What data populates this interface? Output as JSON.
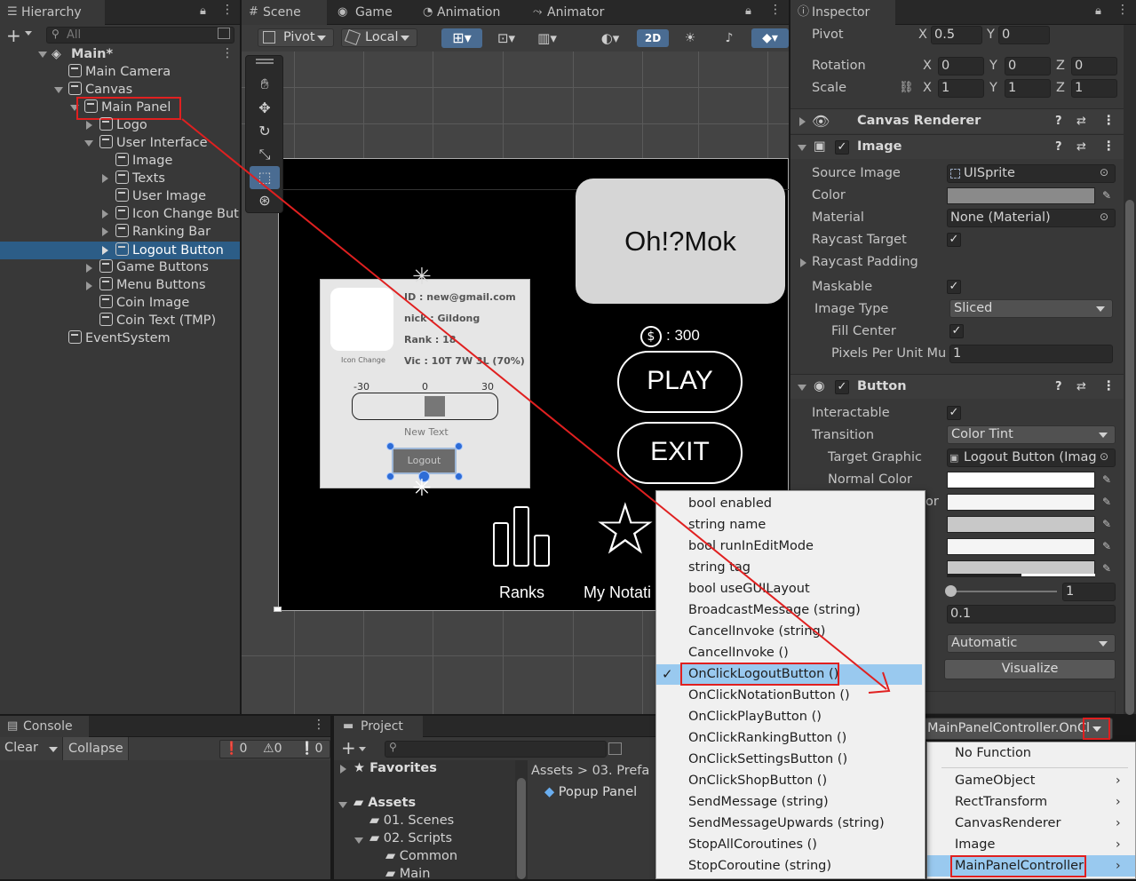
{
  "hierarchy": {
    "tab": "Hierarchy",
    "search_placeholder": "All",
    "items": [
      "Main*",
      "Main Camera",
      "Canvas",
      "Main Panel",
      "Logo",
      "User Interface",
      "Image",
      "Texts",
      "User Image",
      "Icon Change But",
      "Ranking Bar",
      "Logout Button",
      "Game Buttons",
      "Menu Buttons",
      "Coin Image",
      "Coin Text (TMP)",
      "EventSystem"
    ]
  },
  "scene": {
    "tabs": [
      "Scene",
      "Game",
      "Animation",
      "Animator"
    ],
    "pivot": "Pivot",
    "local": "Local",
    "mode2d": "2D",
    "game": {
      "title": "Oh!?Mok",
      "coins": ": 300",
      "coin_symbol": "$",
      "play": "PLAY",
      "exit": "EXIT",
      "ranks": "Ranks",
      "notation": "My Notati",
      "card": {
        "id": "ID : new@gmail.com",
        "nick": "nick : Gildong",
        "rank": "Rank : 18",
        "vic": "Vic : 10T 7W 3L (70%)",
        "icon_change": "Icon Change",
        "slider_min": "-30",
        "slider_mid": "0",
        "slider_max": "30",
        "new_text": "New Text",
        "logout": "Logout"
      }
    }
  },
  "inspector": {
    "tab": "Inspector",
    "pivot_label": "Pivot",
    "pivot_x": "0.5",
    "pivot_y": "0",
    "rotation_label": "Rotation",
    "rot_x": "0",
    "rot_y": "0",
    "rot_z": "0",
    "scale_label": "Scale",
    "scale_x": "1",
    "scale_y": "1",
    "scale_z": "1",
    "canvas_renderer": "Canvas Renderer",
    "image": "Image",
    "source_image_label": "Source Image",
    "source_image": "UISprite",
    "color_label": "Color",
    "material_label": "Material",
    "material": "None (Material)",
    "raycast_target": "Raycast Target",
    "raycast_padding": "Raycast Padding",
    "maskable": "Maskable",
    "image_type_label": "Image Type",
    "image_type": "Sliced",
    "fill_center": "Fill Center",
    "ppu_label": "Pixels Per Unit Mu",
    "ppu": "1",
    "button": "Button",
    "interactable": "Interactable",
    "transition_label": "Transition",
    "transition": "Color Tint",
    "target_graphic_label": "Target Graphic",
    "target_graphic": "Logout Button (Imag",
    "normal_color": "Normal Color",
    "partial_or": "or",
    "mult": "1",
    "fade": "0.1",
    "navigation": "Automatic",
    "visualize": "Visualize",
    "onclick_value": "MainPanelController.OnCl"
  },
  "context_menu": {
    "items": [
      "bool enabled",
      "string name",
      "bool runInEditMode",
      "string tag",
      "bool useGUILayout",
      "BroadcastMessage (string)",
      "CancelInvoke (string)",
      "CancelInvoke ()",
      "OnClickLogoutButton ()",
      "OnClickNotationButton ()",
      "OnClickPlayButton ()",
      "OnClickRankingButton ()",
      "OnClickSettingsButton ()",
      "OnClickShopButton ()",
      "SendMessage (string)",
      "SendMessageUpwards (string)",
      "StopAllCoroutines ()",
      "StopCoroutine (string)"
    ],
    "check": "✓"
  },
  "sub_menu": {
    "items": [
      "No Function",
      "GameObject",
      "RectTransform",
      "CanvasRenderer",
      "Image",
      "MainPanelController"
    ]
  },
  "console": {
    "tab": "Console",
    "clear": "Clear",
    "collapse": "Collapse",
    "err": "0",
    "warn": "0",
    "info": "0"
  },
  "project": {
    "tab": "Project",
    "favorites": "Favorites",
    "assets": "Assets",
    "folders": [
      "01. Scenes",
      "02. Scripts",
      "Common",
      "Main"
    ],
    "breadcrumb_root": "Assets",
    "breadcrumb_sep": ">",
    "breadcrumb_folder": "03. Prefa",
    "item": "Popup Panel"
  }
}
